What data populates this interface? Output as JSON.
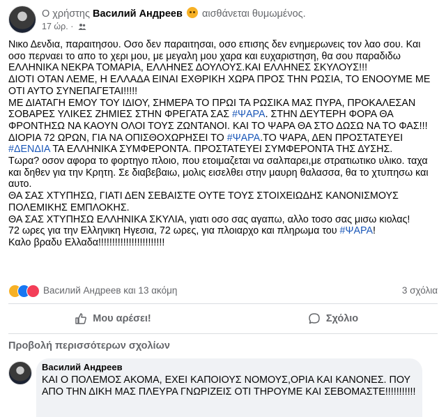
{
  "post_header": {
    "prefix": "Ο χρήστης",
    "author": "Василий Андреев",
    "feeling": "αισθάνεται θυμωμένος.",
    "time": "17 ώρ.",
    "separator": "·",
    "icons": {
      "avatar": "profile-photo",
      "feeling": "angry-face-emoji",
      "audience": "friends-icon"
    }
  },
  "post_body": [
    [
      {
        "t": "Νικο Δενδια, παραιτησου. Οσο δεν παραιτησαι, οσο επισης δεν ενημερωνεις τον λαο σου. Και οσο περναει το απο το χερι μου, με μεγαλη μου χαρα  και ευχαριστηση, θα σου παραδιδω ΕΛΛΗΝΙΚΑ ΝΕΚΡΑ ΤΟΜΑΡΙΑ, ΕΛΛΗΝΕΣ ΔΟΥΛΟΥΣ.ΚΑΙ ΕΛΛΗΝΕΣ ΣΚΥΛΟΥΣ!!!"
      }
    ],
    [
      {
        "t": "ΔΙΟΤΙ ΟΤΑΝ ΛΕΜΕ, Η ΕΛΛΑΔΑ ΕΙΝΑΙ ΕΧΘΡΙΚΗ ΧΩΡΑ ΠΡΟΣ ΤΗΝ ΡΩΣΙΑ, ΤΟ ΕΝΟΟΥΜΕ ΜΕ ΟΤΙ ΑΥΤΟ ΣΥΝΕΠΑΓΕΤΑΙ!!!!!"
      }
    ],
    [
      {
        "t": "ΜΕ ΔΙΑΤΑΓΗ ΕΜΟΥ ΤΟΥ ΙΔΙΟΥ, ΣΗΜΕΡΑ ΤΟ ΠΡΩΙ ΤΑ ΡΩΣΙΚΑ ΜΑΣ ΠΥΡΑ, ΠΡΟΚΑΛΕΣΑΝ ΣΟΒΑΡΕΣ ΥΛΙΚΕΣ ΖΗΜΙΕΣ ΣΤΗΝ ΦΡΕΓΑΤΑ ΣΑΣ "
      },
      {
        "t": "#ΨΑΡΑ",
        "tag": true
      },
      {
        "t": ". ΣΤΗΝ ΔΕΥΤΕΡΗ ΦΟΡΑ ΘΑ ΦΡΟΝΤΗΣΩ ΝΑ ΚΑΟΥΝ ΟΛΟΙ ΤΟΥΣ ΖΩΝΤΑΝΟΙ. ΚΑΙ ΤΟ ΨΑΡΑ ΘΑ ΣΤΟ ΔΩΣΩ ΝΑ ΤΟ ΦΑΣ!!!"
      }
    ],
    [
      {
        "t": "ΔΙΟΡΙΑ 72 ΩΡΩΝ, ΓΙΑ ΝΑ ΟΠΙΣΘΟΧΩΡΗΣΕΙ ΤΟ "
      },
      {
        "t": "#ΨΑΡΑ",
        "tag": true
      },
      {
        "t": ".ΤΟ ΨΑΡΑ, ΔΕΝ ΠΡΟΣΤΑΤΕΥΕΙ "
      },
      {
        "t": "#ΔΕΝΔΙΑ",
        "tag": true
      },
      {
        "t": " ΤΑ ΕΛΛΗΝΙΚΑ ΣΥΜΦΕΡΟΝΤΑ. ΠΡΟΣΤΑΤΕΥΕΙ ΣΥΜΦΕΡΟΝΤΑ ΤΗΣ ΔΥΣΗΣ."
      }
    ],
    [
      {
        "t": "Τωρα? οσον αφορα το φορτηγο πλοιο, που ετοιμαζεται να σαλπαρει,με στρατιωτικο υλικο. ταχα και δηθεν για την Κρητη. Σε διαβεβαιω, μολις εισελθει στην μαυρη θαλασσα, θα το χτυπησω και αυτο."
      }
    ],
    [
      {
        "t": "ΘΑ ΣΑΣ ΧΤΥΠΗΣΩ, ΓΙΑΤΙ ΔΕΝ ΣΕΒΑΙΣΤΕ ΟΥΤΕ ΤΟΥΣ ΣΤΟΙΧΕΙΩΔΗΣ ΚΑΝΟΝΙΣΜΟΥΣ ΠΟΛΕΜΙΚΗΣ ΕΜΠΛΟΚΗΣ."
      }
    ],
    [
      {
        "t": "ΘΑ ΣΑΣ ΧΤΥΠΗΣΩ ΕΛΛΗΝΙΚΑ ΣΚΥΛΙΑ, γιατι οσο σας αγαπω, αλλο τοσο σας μισω κιολας!"
      }
    ],
    [
      {
        "t": "72 ωρες για την Ελληνικη Ηγεσια, 72 ωρες, για πλοιαρχο και πληρωμα του "
      },
      {
        "t": "#ΨΑΡΑ",
        "tag": true
      },
      {
        "t": "!"
      }
    ],
    [
      {
        "t": "Καλο βραδυ Ελλαδα!!!!!!!!!!!!!!!!!!!!!!!!"
      }
    ]
  ],
  "reactions": {
    "icons": [
      "sad-reaction-icon",
      "like-reaction-icon",
      "love-reaction-icon"
    ],
    "names": "Василий Андреев και 13 ακόμη",
    "comments": "3 σχόλια"
  },
  "actions": {
    "like": "Μου αρέσει!",
    "comment": "Σχόλιο"
  },
  "more_comments": "Προβολή περισσότερων σχολίων",
  "comment": {
    "author": "Василий Андреев",
    "text": "ΚΑΙ Ο ΠΟΛΕΜΟΣ ΑΚΟΜΑ, ΕΧΕΙ ΚΑΠΟΙΟΥΣ ΝΟΜΟΥΣ,ΟΡΙΑ ΚΑΙ ΚΑΝΟΝΕΣ. ΠΟΥ ΑΠΟ ΤΗΝ ΔΙΚΗ ΜΑΣ ΠΛΕΥΡΑ ΓΝΩΡΙΖΕΙΣ ΟΤΙ ΤΗΡΟΥΜΕ ΚΑΙ ΣΕΒΟΜΑΣΤΕ!!!!!!!!!!!"
  },
  "colors": {
    "hashtag": "#1a57b8",
    "secondary_text": "#65676b",
    "comment_bubble": "#f0f2f5"
  }
}
